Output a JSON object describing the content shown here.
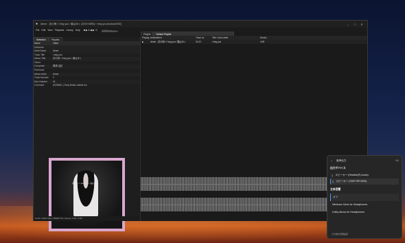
{
  "window": {
    "title": "Aimer - 花の唄 / I beg you / 春はゆく [2019 WEB] / I beg you  [foobar2000]"
  },
  "menu": {
    "items": [
      "File",
      "Edit",
      "View",
      "Playback",
      "Library",
      "Help"
    ],
    "controls": "■ ▶ ‖ ◀ ▶ ⤮"
  },
  "left_tabs": [
    "Selection",
    "Playlists"
  ],
  "properties": {
    "col_name": "Name",
    "col_value": "Value",
    "group": "Metadata",
    "rows": [
      {
        "k": "Artist Name",
        "v": "Aimer"
      },
      {
        "k": "Track Title",
        "v": "I beg you"
      },
      {
        "k": "Album Title",
        "v": "花の唄 / I beg you / 春はゆく"
      },
      {
        "k": "Genre",
        "v": ""
      },
      {
        "k": "Composer",
        "v": "梶浦 由記"
      },
      {
        "k": "Performer",
        "v": ""
      },
      {
        "k": "Album Artist",
        "v": "Aimer"
      },
      {
        "k": "Track Number",
        "v": "2"
      },
      {
        "k": "Disc Number",
        "v": "01"
      },
      {
        "k": "Comment",
        "v": "(P)SMAC | Sony Music Labels Inc."
      }
    ]
  },
  "art_caption": "花の唄 / I beg you / 春はゆく",
  "status": "FLAC | 2897 kbps | 96000 Hz | stereo | 0:01 / 4:09",
  "playlist": {
    "tab_prefix": "Playlist",
    "tab_active": "Default Playlist",
    "columns": [
      "Playing",
      "Artist/album",
      "Track no",
      "Title / track artist",
      "Durati..."
    ],
    "rows": [
      {
        "playing": "▶",
        "artist": "Aimer - 花の唄 / I beg you / 春はゆく",
        "trackno": "01.02",
        "title": "I beg you",
        "dur": "4:09"
      }
    ]
  },
  "flyout": {
    "header": "音声出力",
    "header_right": "Ctrl",
    "devices_label": "出力デバイス",
    "devices": [
      {
        "name": "スピーカー (Realtek(R) Audio)",
        "selected": false
      },
      {
        "name": "スピーカー (XDIP-RR 5300)",
        "selected": true
      }
    ],
    "spatial_label": "立体音響",
    "spatial": [
      {
        "name": "オフ",
        "selected": true
      },
      {
        "name": "Windows Sonic for Headphones",
        "selected": false
      },
      {
        "name": "Dolby Atmos for Headphones",
        "selected": false
      }
    ],
    "footer": "その他の音量設定"
  },
  "colors": {
    "accent": "#3b7bd6",
    "art_border": "#d8a7cf"
  }
}
